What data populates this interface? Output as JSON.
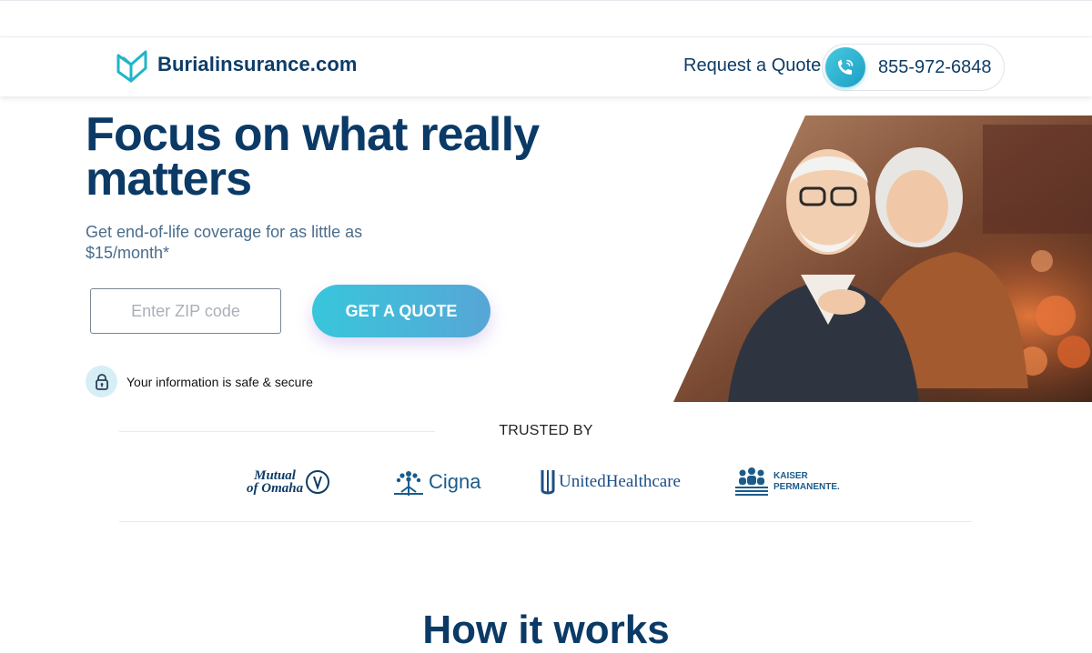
{
  "header": {
    "logo_text": "Burialinsurance.com",
    "request_label": "Request a Quote",
    "phone": "855-972-6848"
  },
  "hero": {
    "title": "Focus on what really matters",
    "subtitle": "Get end-of-life coverage for as little as $15/month*",
    "zip_placeholder": "Enter ZIP code",
    "cta_label": "GET A QUOTE",
    "secure_text": "Your information is safe & secure"
  },
  "trusted": {
    "label": "TRUSTED BY",
    "brands": [
      {
        "line1": "Mutual",
        "line2": "of Omaha"
      },
      {
        "name": "Cigna"
      },
      {
        "name": "UnitedHealthcare"
      },
      {
        "line1": "KAISER",
        "line2": "PERMANENTE."
      }
    ]
  },
  "section": {
    "how_title": "How it works"
  },
  "colors": {
    "brand_navy": "#0b3a66",
    "accent_teal": "#38c6db",
    "logo_teal": "#1fb5c9"
  },
  "icons": [
    "logo-leaf-icon",
    "phone-icon",
    "lock-icon",
    "tree-icon",
    "family-icon"
  ]
}
